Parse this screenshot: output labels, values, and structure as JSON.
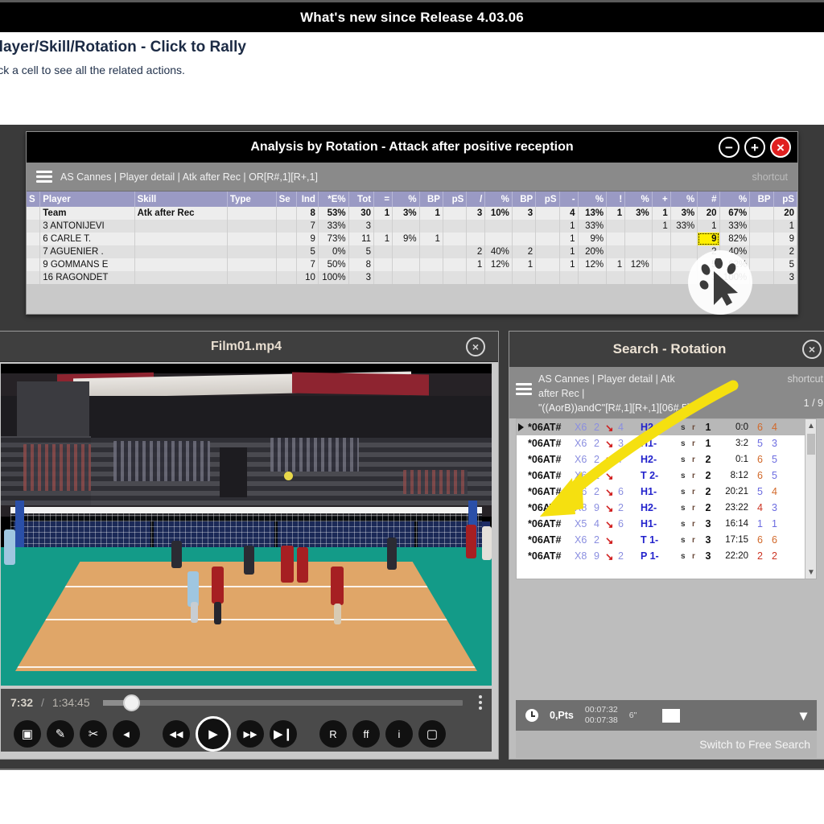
{
  "banner": {
    "title": "What's new since Release 4.03.06"
  },
  "slide": {
    "title": "Player/Skill/Rotation - Click to Rally",
    "subtitle": "click a cell to see all the related actions."
  },
  "analysis_window": {
    "title": "Analysis by Rotation - Attack after positive reception",
    "window_buttons": {
      "minimize": "−",
      "maximize": "+",
      "close": "×"
    },
    "menu": {
      "hamburger": "menu-icon",
      "breadcrumb": "AS Cannes  |  Player detail  |  Atk after Rec  |  OR[R#,1][R+,1]",
      "shortcut": "shortcut"
    },
    "table": {
      "headers": [
        "S",
        "Player",
        "Skill",
        "Type",
        "Se",
        "Ind",
        "*E%",
        "Tot",
        "=",
        "%",
        "BP",
        "pS",
        "/",
        "%",
        "BP",
        "pS",
        "-",
        "%",
        "!",
        "%",
        "+",
        "%",
        "#",
        "%",
        "BP",
        "pS"
      ],
      "rows": [
        {
          "cells": [
            "",
            "Team",
            "Atk after Rec",
            "",
            "",
            "8",
            "53%",
            "30",
            "1",
            "3%",
            "1",
            "",
            "3",
            "10%",
            "3",
            "",
            "4",
            "13%",
            "1",
            "3%",
            "1",
            "3%",
            "20",
            "67%",
            "",
            "20"
          ],
          "selected_index": -1,
          "bold": true
        },
        {
          "cells": [
            "",
            "3 ANTONIJEVI",
            "",
            "",
            "",
            "7",
            "33%",
            "3",
            "",
            "",
            "",
            "",
            "",
            "",
            "",
            "",
            "1",
            "33%",
            "",
            "",
            "1",
            "33%",
            "1",
            "33%",
            "",
            "1"
          ],
          "selected_index": -1,
          "bold": false
        },
        {
          "cells": [
            "",
            "6 CARLE T.",
            "",
            "",
            "",
            "9",
            "73%",
            "11",
            "1",
            "9%",
            "1",
            "",
            "",
            "",
            "",
            "",
            "1",
            "9%",
            "",
            "",
            "",
            "",
            "9",
            "82%",
            "",
            "9"
          ],
          "selected_index": 22,
          "bold": false
        },
        {
          "cells": [
            "",
            "7 AGUENIER .",
            "",
            "",
            "",
            "5",
            "0%",
            "5",
            "",
            "",
            "",
            "",
            "2",
            "40%",
            "2",
            "",
            "1",
            "20%",
            "",
            "",
            "",
            "",
            "2",
            "40%",
            "",
            "2"
          ],
          "selected_index": -1,
          "bold": false
        },
        {
          "cells": [
            "",
            "9 GOMMANS E",
            "",
            "",
            "",
            "7",
            "50%",
            "8",
            "",
            "",
            "",
            "",
            "1",
            "12%",
            "1",
            "",
            "1",
            "12%",
            "1",
            "12%",
            "",
            "",
            "5",
            "62%",
            "",
            "5"
          ],
          "selected_index": -1,
          "bold": false
        },
        {
          "cells": [
            "",
            "16 RAGONDET",
            "",
            "",
            "",
            "10",
            "100%",
            "3",
            "",
            "",
            "",
            "",
            "",
            "",
            "",
            "",
            "",
            "",
            "",
            "",
            "",
            "",
            "3",
            "100%",
            "",
            "3"
          ],
          "selected_index": -1,
          "bold": false
        }
      ]
    },
    "cursor_badge": "click-cursor-icon",
    "arrow": "yellow-arrow-annotation"
  },
  "video_window": {
    "title": "Film01.mp4",
    "close": "×",
    "controls": {
      "current_time": "7:32",
      "separator": "/",
      "total_time": "1:34:45",
      "progress_percent": 7,
      "buttons": [
        {
          "name": "snapshot-button",
          "icon": "camera-icon",
          "glyph": "▣"
        },
        {
          "name": "draw-button",
          "icon": "pencil-icon",
          "glyph": "✎"
        },
        {
          "name": "cut-button",
          "icon": "scissors-icon",
          "glyph": "✂"
        },
        {
          "name": "mute-button",
          "icon": "speaker-mute-icon",
          "glyph": "◂"
        },
        {
          "name": "rewind-button",
          "icon": "rewind-icon",
          "glyph": "◀◀"
        },
        {
          "name": "play-button",
          "icon": "play-icon",
          "glyph": "▶"
        },
        {
          "name": "fast-forward-button",
          "icon": "fast-forward-icon",
          "glyph": "▶▶"
        },
        {
          "name": "next-frame-button",
          "icon": "step-forward-icon",
          "glyph": "▶❙"
        },
        {
          "name": "rally-button",
          "icon": "r-letter-icon",
          "glyph": "R"
        },
        {
          "name": "ff-button",
          "icon": "ff-letter-icon",
          "glyph": "ff"
        },
        {
          "name": "info-button",
          "icon": "info-icon",
          "glyph": "i"
        },
        {
          "name": "screen-button",
          "icon": "monitor-icon",
          "glyph": "▢"
        }
      ],
      "more": "kebab-menu-icon"
    }
  },
  "search_window": {
    "title": "Search - Rotation",
    "close": "×",
    "menu": {
      "hamburger": "menu-icon",
      "breadcrumb_line1": "AS Cannes   |   Player detail   |   Atk",
      "breadcrumb_line2": "after Rec   |",
      "query": "\"((AorB))andC\"[R#,1][R+,1][06#,5]",
      "shortcut": "shortcut",
      "page": "1 / 9"
    },
    "results": [
      {
        "code": "*06AT#",
        "x": "X6",
        "n1": "2",
        "n2": "4",
        "type": "H2-",
        "s": "s",
        "r": "r",
        "set": "1",
        "score": "0:0",
        "a": "6",
        "b": "4",
        "a_color": "orange",
        "b_color": "orange",
        "selected": true
      },
      {
        "code": "*06AT#",
        "x": "X6",
        "n1": "2",
        "n2": "3",
        "type": "H1-",
        "s": "s",
        "r": "r",
        "set": "1",
        "score": "3:2",
        "a": "5",
        "b": "3",
        "a_color": "blue",
        "b_color": "blue",
        "selected": false
      },
      {
        "code": "*06AT#",
        "x": "X6",
        "n1": "2",
        "n2": "7",
        "type": "H2-",
        "s": "s",
        "r": "r",
        "set": "2",
        "score": "0:1",
        "a": "6",
        "b": "5",
        "a_color": "orange",
        "b_color": "blue",
        "selected": false
      },
      {
        "code": "*06AT#",
        "x": "X6",
        "n1": "2",
        "n2": "",
        "type": "T 2-",
        "s": "s",
        "r": "r",
        "set": "2",
        "score": "8:12",
        "a": "6",
        "b": "5",
        "a_color": "orange",
        "b_color": "blue",
        "selected": false
      },
      {
        "code": "*06AT#",
        "x": "X6",
        "n1": "2",
        "n2": "6",
        "type": "H1-",
        "s": "s",
        "r": "r",
        "set": "2",
        "score": "20:21",
        "a": "5",
        "b": "4",
        "a_color": "blue",
        "b_color": "orange",
        "selected": false
      },
      {
        "code": "*06AT#",
        "x": "X8",
        "n1": "9",
        "n2": "2",
        "type": "H2-",
        "s": "s",
        "r": "r",
        "set": "2",
        "score": "23:22",
        "a": "4",
        "b": "3",
        "a_color": "red",
        "b_color": "blue",
        "selected": false
      },
      {
        "code": "*06AT#",
        "x": "X5",
        "n1": "4",
        "n2": "6",
        "type": "H1-",
        "s": "s",
        "r": "r",
        "set": "3",
        "score": "16:14",
        "a": "1",
        "b": "1",
        "a_color": "blue",
        "b_color": "blue",
        "selected": false
      },
      {
        "code": "*06AT#",
        "x": "X6",
        "n1": "2",
        "n2": "",
        "type": "T 1-",
        "s": "s",
        "r": "r",
        "set": "3",
        "score": "17:15",
        "a": "6",
        "b": "6",
        "a_color": "orange",
        "b_color": "orange",
        "selected": false
      },
      {
        "code": "*06AT#",
        "x": "X8",
        "n1": "9",
        "n2": "2",
        "type": "P 1-",
        "s": "s",
        "r": "r",
        "set": "3",
        "score": "22:20",
        "a": "2",
        "b": "2",
        "a_color": "red",
        "b_color": "red",
        "selected": false
      }
    ],
    "status": {
      "clock_icon": "clock-icon",
      "points": "0,Pts",
      "time_start": "00:07:32",
      "time_end": "00:07:38",
      "duration": "6\"",
      "film_icon": "film-strip-icon",
      "expand_icon": "chevron-down-icon"
    },
    "free_search": "Switch to Free Search"
  },
  "colors": {
    "banner_bg": "#000000",
    "table_header": "#9a9ac4",
    "selection_yellow": "#ffef00",
    "arrow_yellow": "#f5e010",
    "close_red": "#e02020",
    "window_chrome": "#3f3f3f",
    "menu_gray": "#8a8a8a"
  }
}
